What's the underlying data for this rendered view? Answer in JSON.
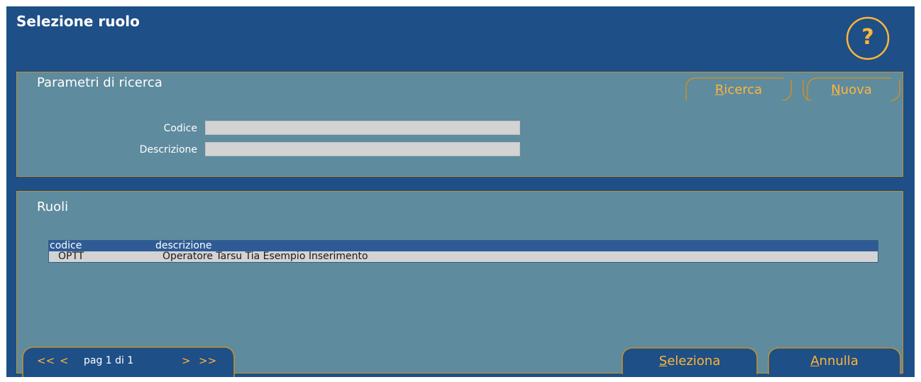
{
  "window": {
    "title": "Selezione ruolo",
    "help_label": "?"
  },
  "search": {
    "title": "Parametri di ricerca",
    "buttons": {
      "search_first": "R",
      "search_rest": "icerca",
      "new_first": "N",
      "new_rest": "uova"
    },
    "fields": [
      {
        "label": "Codice",
        "value": ""
      },
      {
        "label": "Descrizione",
        "value": ""
      }
    ]
  },
  "results": {
    "title": "Ruoli",
    "columns": [
      "codice",
      "descrizione"
    ],
    "rows": [
      {
        "codice": "OPTT",
        "descrizione": "Operatore Tarsu Tia Esempio Inserimento"
      }
    ]
  },
  "pager": {
    "first": "<<",
    "prev": "<",
    "label": "pag 1 di 1",
    "next": ">",
    "last": ">>"
  },
  "actions": {
    "select_first": "S",
    "select_rest": "eleziona",
    "cancel_first": "A",
    "cancel_rest": "nnulla"
  },
  "colors": {
    "frame": "#1e4f86",
    "panel": "#5e8b9e",
    "accent": "#ffb53b",
    "border": "#c8902a"
  }
}
